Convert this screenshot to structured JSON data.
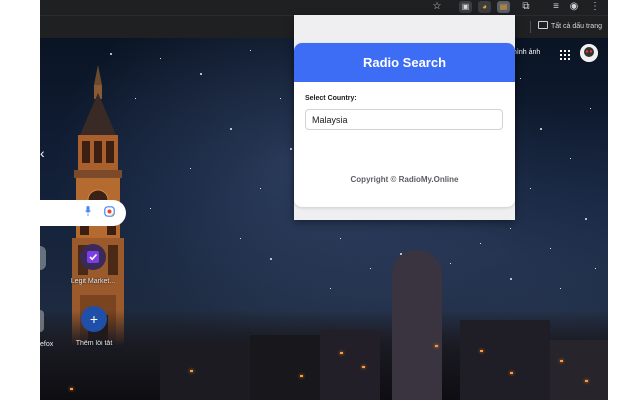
{
  "browser": {
    "bookmarks_bar": {
      "all_bookmarks_label": "Tất cả dấu trang"
    },
    "ntp": {
      "top_right_link": "hình ảnh",
      "shortcuts": [
        {
          "label": "Legit Market...",
          "color": "#7b3fe4"
        },
        {
          "label": "Thêm lối tắt",
          "color": "#1f4fa8"
        }
      ],
      "left_partial_label": "efox"
    }
  },
  "popup": {
    "header_title": "Radio Search",
    "country_label": "Select Country:",
    "country_value": "Malaysia",
    "copyright": "Copyright © RadioMy.Online",
    "accent_color": "#3d6df5"
  }
}
